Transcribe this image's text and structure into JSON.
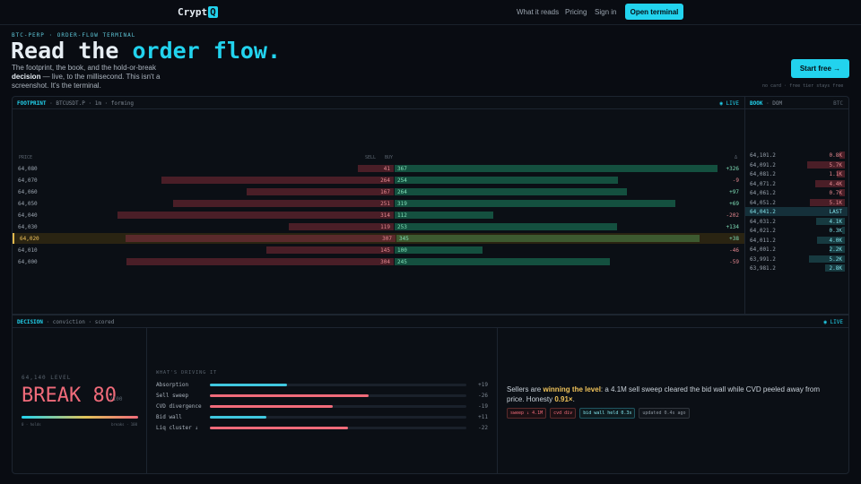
{
  "nav": {
    "brand_text": "Crypt",
    "brand_mark": "Q",
    "links": [
      "What it reads",
      "Pricing",
      "Sign in"
    ],
    "cta": "Open terminal"
  },
  "hero": {
    "eyebrow": "BTC-PERP · ORDER-FLOW TERMINAL",
    "headline_a": "Read the ",
    "headline_b": "order flow.",
    "sub_a": "The footprint, the book, and the hold-or-break ",
    "sub_b": "decision",
    "sub_c": " — live, to the millisecond. This isn't a screenshot. It's the terminal.",
    "start": "Start free →",
    "fine": "no card · free tier stays free"
  },
  "footprint": {
    "head_a": "FOOTPRINT",
    "head_b": " · BTCUSDT.P · 1m · forming",
    "live": "◉ LIVE",
    "cols": {
      "price": "PRICE",
      "sell": "SELL",
      "buy": "BUY",
      "delta": "Δ"
    },
    "rows": [
      {
        "price": "64,080",
        "sell": "41",
        "buy": "367",
        "delta": "+326",
        "s": 41,
        "b": 367,
        "cur": false
      },
      {
        "price": "64,070",
        "sell": "264",
        "buy": "254",
        "delta": "-9",
        "s": 264,
        "b": 254,
        "cur": false
      },
      {
        "price": "64,060",
        "sell": "167",
        "buy": "264",
        "delta": "+97",
        "s": 167,
        "b": 264,
        "cur": false
      },
      {
        "price": "64,050",
        "sell": "251",
        "buy": "319",
        "delta": "+69",
        "s": 251,
        "b": 319,
        "cur": false
      },
      {
        "price": "64,040",
        "sell": "314",
        "buy": "112",
        "delta": "-202",
        "s": 314,
        "b": 112,
        "cur": false
      },
      {
        "price": "64,030",
        "sell": "119",
        "buy": "253",
        "delta": "+134",
        "s": 119,
        "b": 253,
        "cur": false
      },
      {
        "price": "64,020",
        "sell": "307",
        "buy": "345",
        "delta": "+38",
        "s": 307,
        "b": 345,
        "cur": true
      },
      {
        "price": "64,010",
        "sell": "145",
        "buy": "100",
        "delta": "-46",
        "s": 145,
        "b": 100,
        "cur": false
      },
      {
        "price": "64,000",
        "sell": "304",
        "buy": "245",
        "delta": "-59",
        "s": 304,
        "b": 245,
        "cur": false
      }
    ]
  },
  "book": {
    "head_a": "BOOK",
    "head_b": " · DOM",
    "unit": "BTC",
    "rows": [
      {
        "price": "64,101.2",
        "size": "0.8K",
        "side": "ask",
        "frac": 0.14
      },
      {
        "price": "64,091.2",
        "size": "5.7K",
        "side": "ask",
        "frac": 0.95
      },
      {
        "price": "64,081.2",
        "size": "1.1K",
        "side": "ask",
        "frac": 0.2
      },
      {
        "price": "64,071.2",
        "size": "4.4K",
        "side": "ask",
        "frac": 0.76
      },
      {
        "price": "64,061.2",
        "size": "0.7K",
        "side": "ask",
        "frac": 0.13
      },
      {
        "price": "64,051.2",
        "size": "5.1K",
        "side": "ask",
        "frac": 0.88
      },
      {
        "price": "64,041.2",
        "size": "LAST",
        "side": "last",
        "frac": 0
      },
      {
        "price": "64,031.2",
        "size": "4.1K",
        "side": "bid",
        "frac": 0.72
      },
      {
        "price": "64,021.2",
        "size": "0.3K",
        "side": "bid",
        "frac": 0.06
      },
      {
        "price": "64,011.2",
        "size": "4.0K",
        "side": "bid",
        "frac": 0.7
      },
      {
        "price": "64,001.2",
        "size": "2.2K",
        "side": "bid",
        "frac": 0.39
      },
      {
        "price": "63,991.2",
        "size": "5.2K",
        "side": "bid",
        "frac": 0.9
      },
      {
        "price": "63,981.2",
        "size": "2.8K",
        "side": "bid",
        "frac": 0.49
      }
    ]
  },
  "decision": {
    "head_a": "DECISION",
    "head_b": " · conviction · scored",
    "live": "◉ LIVE",
    "level_label": "64,140 LEVEL",
    "verdict": "BREAK 80",
    "outof": "/100",
    "scale_l": "0 · holds",
    "scale_r": "breaks · 100",
    "drivers_title": "WHAT'S DRIVING IT",
    "drivers": [
      {
        "label": "Absorption",
        "val": "+19",
        "frac": 0.3,
        "color": "#40c8e0"
      },
      {
        "label": "Sell sweep",
        "val": "-26",
        "frac": 0.62,
        "color": "#f06b7a"
      },
      {
        "label": "CVD divergence",
        "val": "-19",
        "frac": 0.48,
        "color": "#f06b7a"
      },
      {
        "label": "Bid wall",
        "val": "+11",
        "frac": 0.22,
        "color": "#40c8e0"
      },
      {
        "label": "Liq cluster ↓",
        "val": "-22",
        "frac": 0.54,
        "color": "#f06b7a"
      }
    ],
    "narr_a": "Sellers are ",
    "narr_b": "winning the level",
    "narr_c": ": a 4.1M sell sweep cleared the bid wall while CVD peeled away from price. Honesty ",
    "narr_d": "0.91×",
    "narr_e": ".",
    "chips": [
      {
        "text": "sweep ↓ 4.1M",
        "kind": "red"
      },
      {
        "text": "cvd div",
        "kind": "red"
      },
      {
        "text": "bid wall held 0.3s",
        "kind": "cyan"
      },
      {
        "text": "updated 0.4s ago",
        "kind": "grey"
      }
    ]
  }
}
